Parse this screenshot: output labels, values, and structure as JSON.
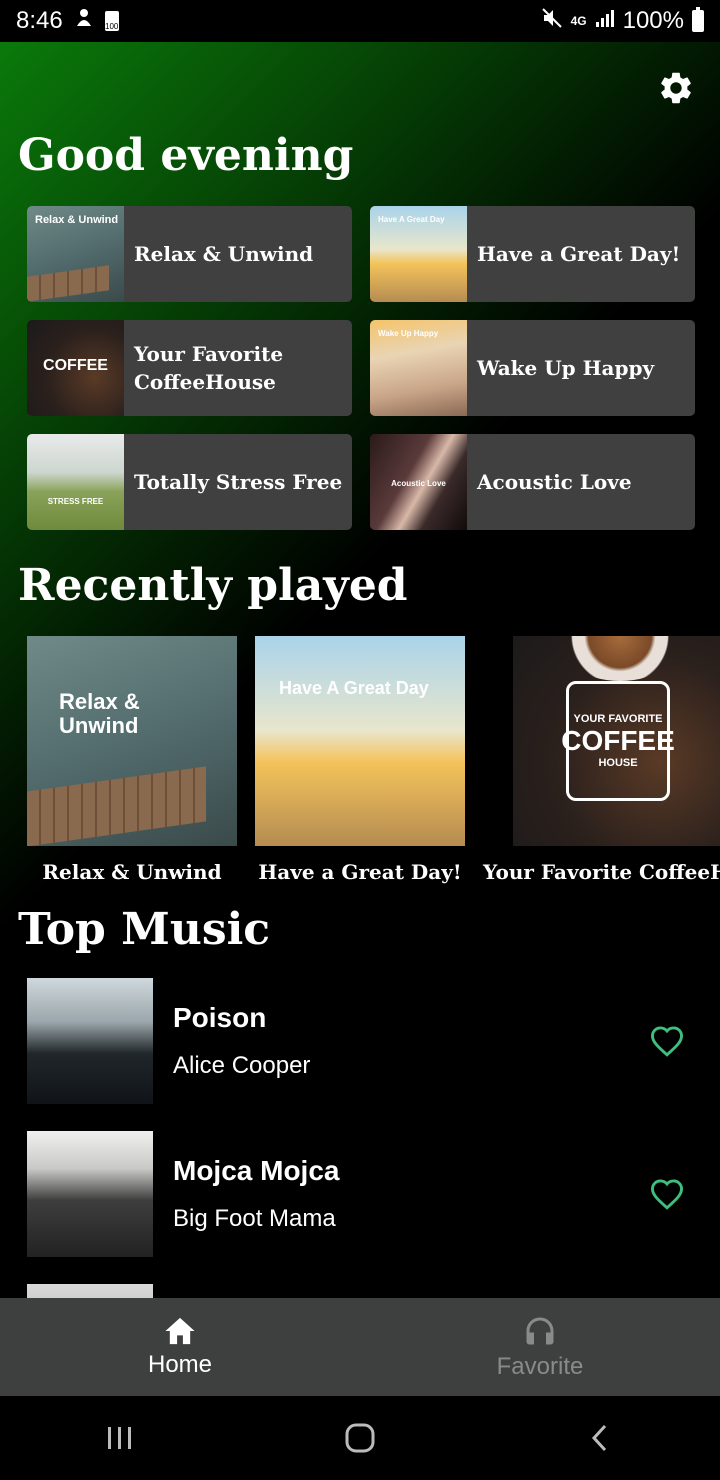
{
  "status_bar": {
    "time": "8:46",
    "sd_label": "100",
    "network": "4G",
    "battery": "100%"
  },
  "header": {
    "greeting": "Good evening"
  },
  "shortcuts": [
    {
      "label": "Relax & Unwind",
      "art_text": "Relax & Unwind"
    },
    {
      "label": "Have a Great Day!",
      "art_text": "Have A Great Day"
    },
    {
      "label": "Your Favorite CoffeeHouse",
      "art_text": "COFFEE"
    },
    {
      "label": "Wake Up Happy",
      "art_text": "Wake Up Happy"
    },
    {
      "label": "Totally Stress Free",
      "art_text": "STRESS FREE"
    },
    {
      "label": "Acoustic Love",
      "art_text": "Acoustic Love"
    }
  ],
  "recently_played": {
    "title": "Recently played",
    "items": [
      {
        "label": "Relax & Unwind",
        "art_text_1": "Relax &",
        "art_text_2": "Unwind"
      },
      {
        "label": "Have a Great Day!",
        "art_text_1": "Have A Great Day"
      },
      {
        "label": "Your Favorite CoffeeH",
        "badge_1": "YOUR FAVORITE",
        "badge_2": "COFFEE",
        "badge_3": "HOUSE"
      }
    ]
  },
  "top_music": {
    "title": "Top Music",
    "tracks": [
      {
        "title": "Poison",
        "artist": "Alice Cooper"
      },
      {
        "title": "Mojca Mojca",
        "artist": "Big Foot Mama"
      }
    ]
  },
  "bottom_nav": {
    "home_label": "Home",
    "favorite_label": "Favorite"
  },
  "colors": {
    "accent_green": "#3fbf7f",
    "tile_bg": "#404040",
    "nav_bg": "#3e3f3f"
  }
}
